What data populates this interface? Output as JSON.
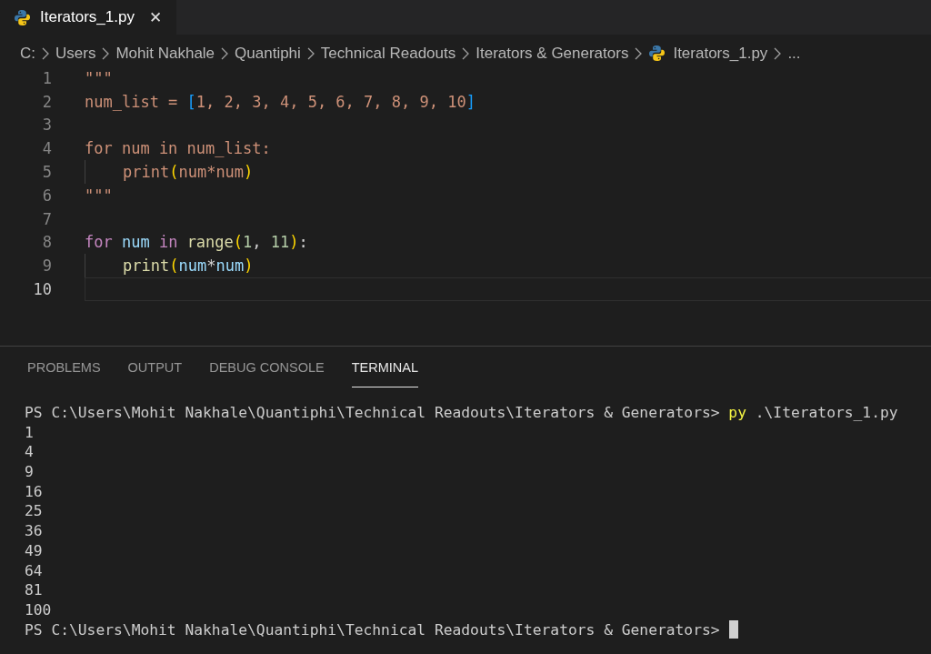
{
  "tab": {
    "title": "Iterators_1.py",
    "close": "✕",
    "selected": true
  },
  "breadcrumb": [
    {
      "label": "C:",
      "kind": "folder"
    },
    {
      "label": "Users",
      "kind": "folder"
    },
    {
      "label": "Mohit Nakhale",
      "kind": "folder"
    },
    {
      "label": "Quantiphi",
      "kind": "folder"
    },
    {
      "label": "Technical Readouts",
      "kind": "folder"
    },
    {
      "label": "Iterators & Generators",
      "kind": "folder"
    },
    {
      "label": "Iterators_1.py",
      "kind": "file"
    },
    {
      "label": "...",
      "kind": "more"
    }
  ],
  "editor": {
    "lines": [
      {
        "number": "1",
        "current": false,
        "indented": false,
        "tokens": [
          {
            "text": "\"\"\"",
            "kind": "string"
          }
        ]
      },
      {
        "number": "2",
        "current": false,
        "indented": false,
        "tokens": [
          {
            "text": "num_list = ",
            "kind": "string"
          },
          {
            "text": "[",
            "kind": "square"
          },
          {
            "text": "1, 2, 3, 4, 5, 6, 7, 8, 9, 10",
            "kind": "string"
          },
          {
            "text": "]",
            "kind": "square"
          }
        ]
      },
      {
        "number": "3",
        "current": false,
        "indented": false
      },
      {
        "number": "4",
        "current": false,
        "indented": false,
        "tokens": [
          {
            "text": "for num in num_list:",
            "kind": "string"
          }
        ]
      },
      {
        "number": "5",
        "current": false,
        "indented": true,
        "tokens": [
          {
            "text": "print",
            "kind": "string"
          },
          {
            "text": "(",
            "kind": "paren"
          },
          {
            "text": "num*num",
            "kind": "string"
          },
          {
            "text": ")",
            "kind": "paren"
          }
        ]
      },
      {
        "number": "6",
        "current": false,
        "indented": false,
        "tokens": [
          {
            "text": "\"\"\"",
            "kind": "string"
          }
        ]
      },
      {
        "number": "7",
        "current": false,
        "indented": false
      },
      {
        "number": "8",
        "current": false,
        "indented": false,
        "tokens": [
          {
            "text": "for ",
            "kind": "keyword"
          },
          {
            "text": "num ",
            "kind": "variable"
          },
          {
            "text": "in ",
            "kind": "keyword"
          },
          {
            "text": "range",
            "kind": "function"
          },
          {
            "text": "(",
            "kind": "paren"
          },
          {
            "text": "1",
            "kind": "number"
          },
          {
            "text": ", ",
            "kind": "plain"
          },
          {
            "text": "11",
            "kind": "number"
          },
          {
            "text": ")",
            "kind": "paren"
          },
          {
            "text": ":",
            "kind": "plain"
          }
        ]
      },
      {
        "number": "9",
        "current": false,
        "indented": true,
        "tokens": [
          {
            "text": "print",
            "kind": "function"
          },
          {
            "text": "(",
            "kind": "paren"
          },
          {
            "text": "num",
            "kind": "variable"
          },
          {
            "text": "*",
            "kind": "plain"
          },
          {
            "text": "num",
            "kind": "variable"
          },
          {
            "text": ")",
            "kind": "paren"
          }
        ]
      },
      {
        "number": "10",
        "current": true,
        "indented": false
      }
    ]
  },
  "panel_tabs": [
    {
      "label": "PROBLEMS",
      "selected": false
    },
    {
      "label": "OUTPUT",
      "selected": false
    },
    {
      "label": "DEBUG CONSOLE",
      "selected": false
    },
    {
      "label": "TERMINAL",
      "selected": true
    }
  ],
  "terminal": [
    {
      "kind": "command",
      "prompt": "PS C:\\Users\\Mohit Nakhale\\Quantiphi\\Technical Readouts\\Iterators & Generators>",
      "command": "py",
      "args": ".\\Iterators_1.py"
    },
    {
      "kind": "output",
      "text": "1"
    },
    {
      "kind": "output",
      "text": "4"
    },
    {
      "kind": "output",
      "text": "9"
    },
    {
      "kind": "output",
      "text": "16"
    },
    {
      "kind": "output",
      "text": "25"
    },
    {
      "kind": "output",
      "text": "36"
    },
    {
      "kind": "output",
      "text": "49"
    },
    {
      "kind": "output",
      "text": "64"
    },
    {
      "kind": "output",
      "text": "81"
    },
    {
      "kind": "output",
      "text": "100"
    },
    {
      "kind": "prompt",
      "prompt": "PS C:\\Users\\Mohit Nakhale\\Quantiphi\\Technical Readouts\\Iterators & Generators>",
      "cursor": true
    }
  ]
}
